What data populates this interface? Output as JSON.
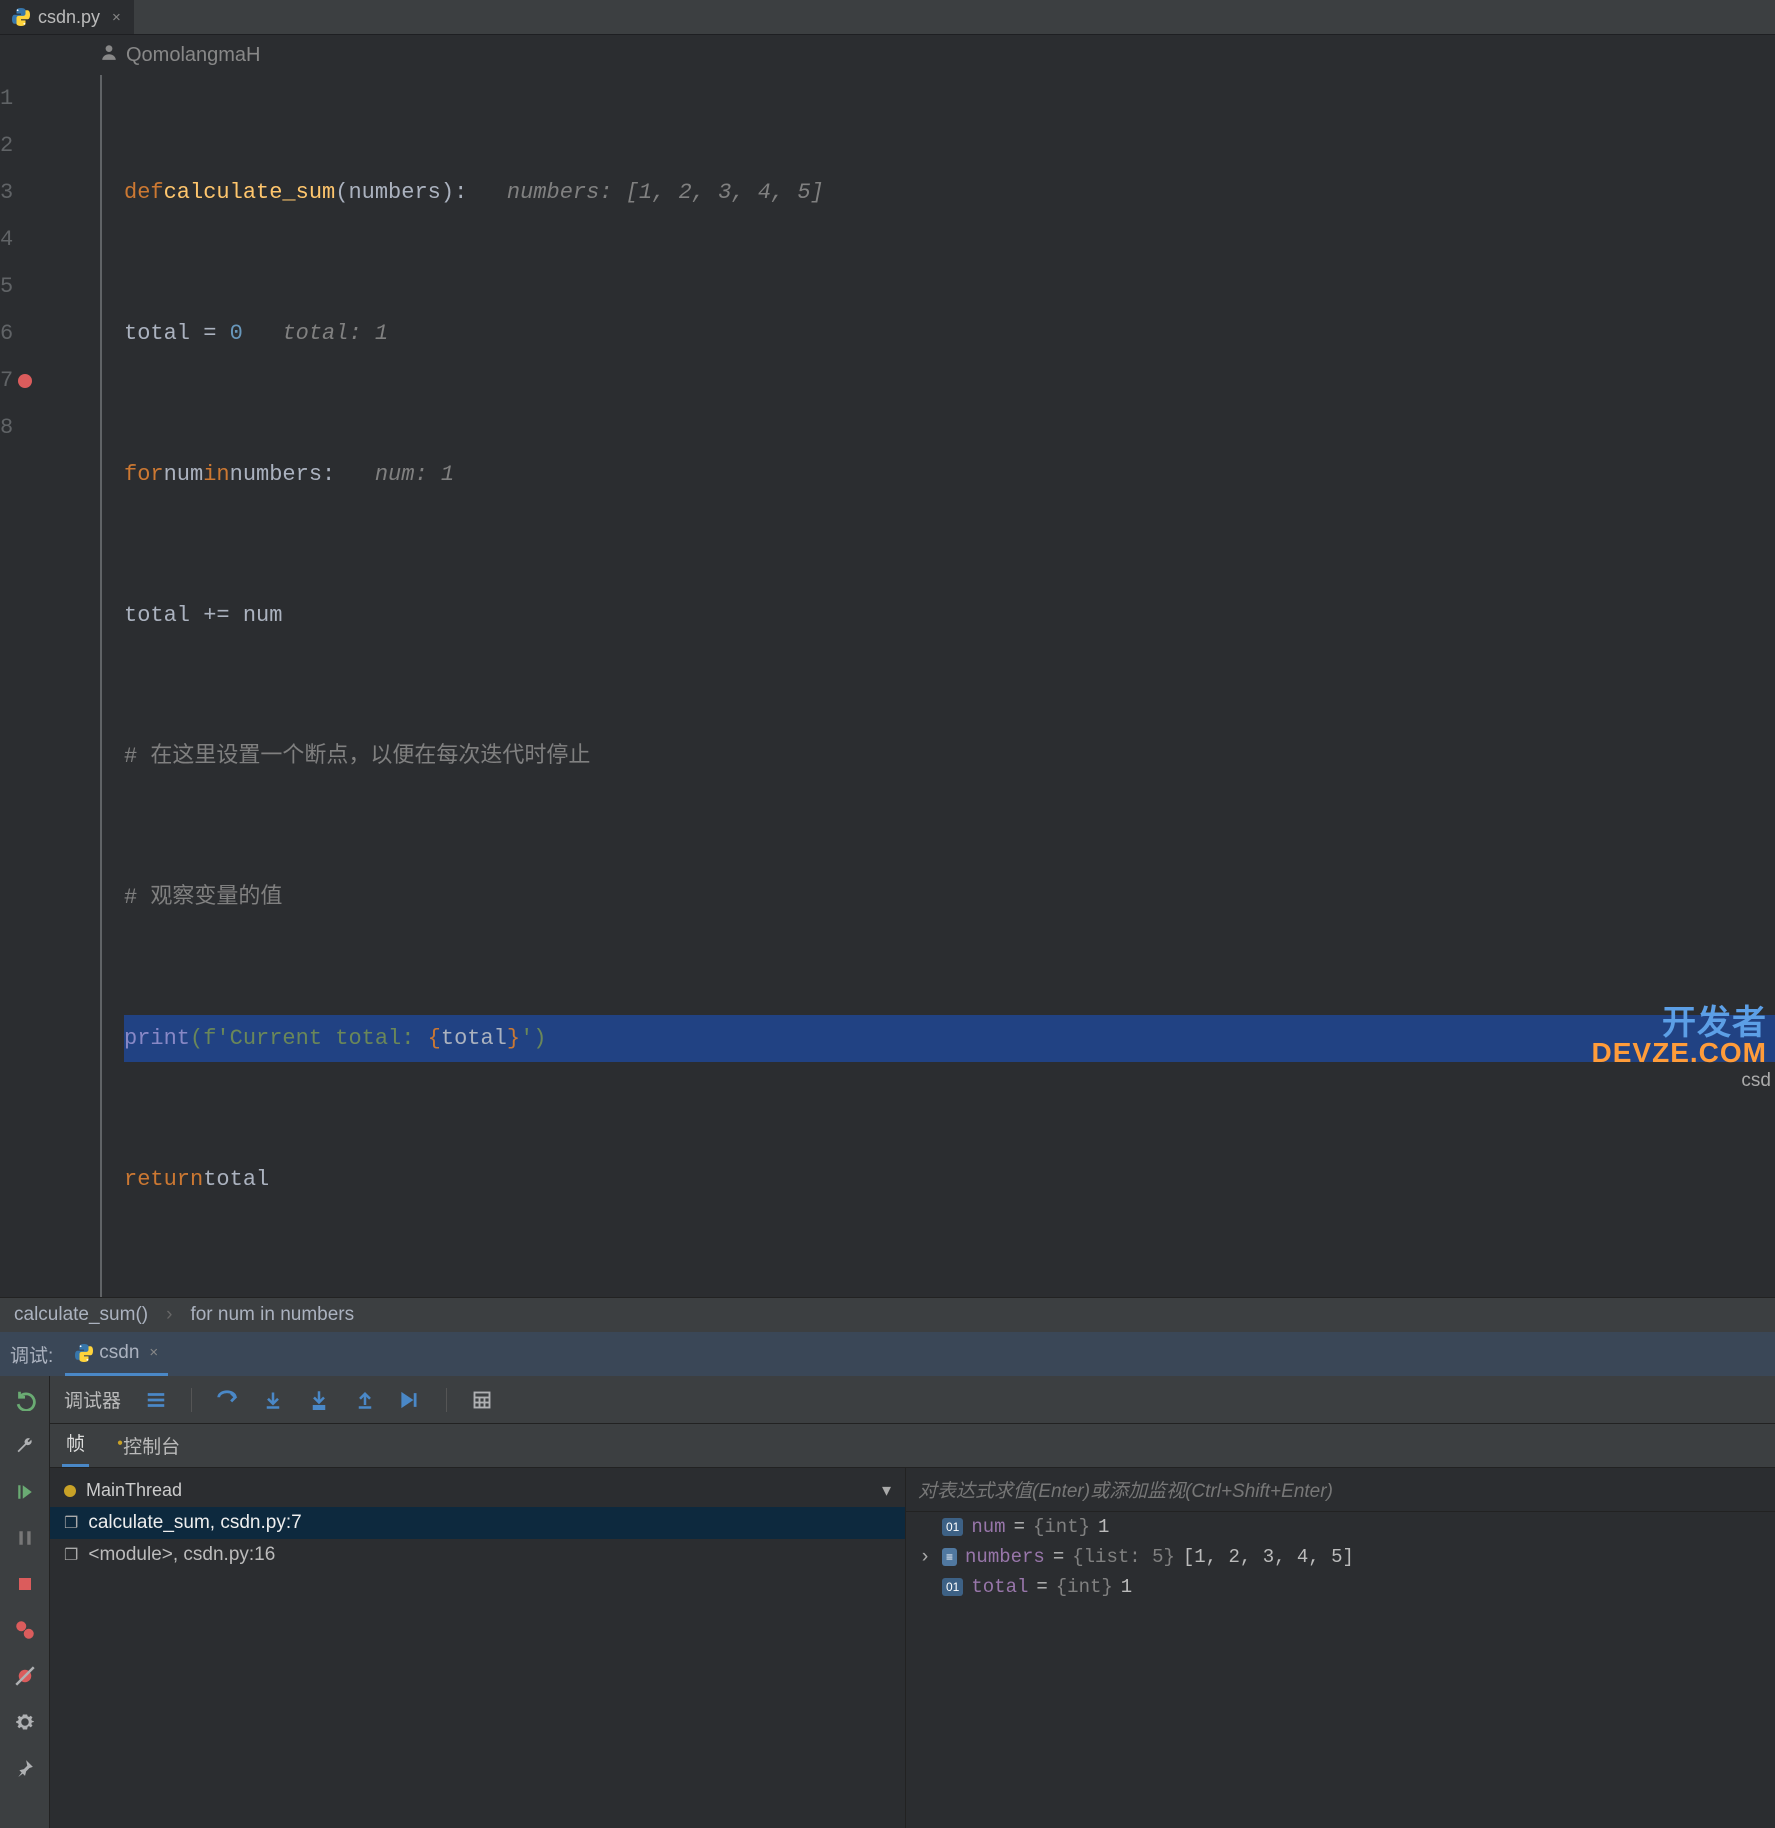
{
  "tab": {
    "filename": "csdn.py"
  },
  "author": "QomolangmaH",
  "code": {
    "lines": [
      1,
      2,
      3,
      4,
      5,
      6,
      7,
      8
    ],
    "breakpoint_line": 7,
    "hint_numbers": "numbers: [1, 2, 3, 4, 5]",
    "hint_total": "total: 1",
    "hint_num": "num: 1",
    "def": "def",
    "fn_name": "calculate_sum",
    "param": "(numbers):",
    "l2a": "total = ",
    "l2b": "0",
    "for": "for",
    "loopvar": "num",
    "in": "in",
    "iter": "numbers:",
    "l4": "total += num",
    "l5": "# 在这里设置一个断点，以便在每次迭代时停止",
    "l6": "# 观察变量的值",
    "print": "print",
    "fprefix": "(f'",
    "fstr": "Current total: ",
    "fbrace_open": "{",
    "fvar": "total",
    "fbrace_close": "}",
    "fsuffix": "')",
    "return": "return",
    "retvar": "total"
  },
  "breadcrumb": {
    "a": "calculate_sum()",
    "b": "for num in numbers"
  },
  "debug": {
    "label": "调试:",
    "tab": "csdn",
    "debugger_label": "调试器",
    "sub_frames": "帧",
    "sub_console": "控制台",
    "thread": "MainThread",
    "frame1": "calculate_sum, csdn.py:7",
    "frame2": "<module>, csdn.py:16",
    "vars_placeholder": "对表达式求值(Enter)或添加监视(Ctrl+Shift+Enter)",
    "var_num_name": "num",
    "var_num_type": "{int}",
    "var_num_val": "1",
    "var_numbers_name": "numbers",
    "var_numbers_type": "{list: 5}",
    "var_numbers_val": "[1, 2, 3, 4, 5]",
    "var_total_name": "total",
    "var_total_type": "{int}",
    "var_total_val": "1",
    "eq": " = ",
    "badge01": "01"
  },
  "watermark": {
    "l1": "开发者",
    "l2": "DEVZE.COM"
  },
  "status_right": "csd"
}
